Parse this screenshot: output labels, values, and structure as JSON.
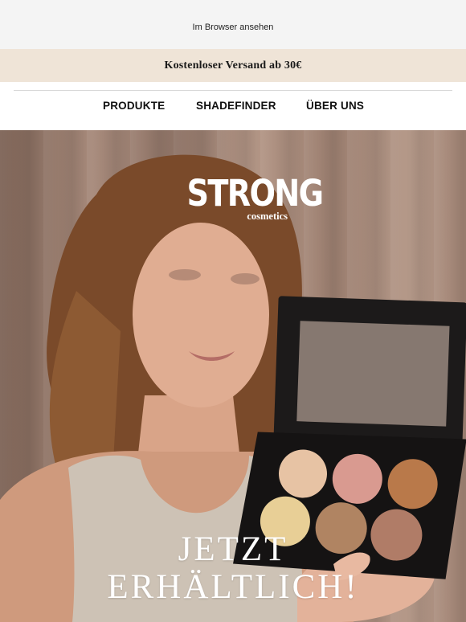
{
  "topbar": {
    "view_in_browser": "Im Browser ansehen"
  },
  "shipping": {
    "text": "Kostenloser Versand ab 30€"
  },
  "nav": {
    "items": [
      "PRODUKTE",
      "SHADEFINDER",
      "ÜBER UNS"
    ]
  },
  "hero": {
    "brand_word": "STRONG",
    "brand_sub": "cosmetics",
    "headline_line1": "JETZT",
    "headline_line2": "ERHÄLTLICH!"
  },
  "colors": {
    "shipping_bg": "#efe4d7",
    "accent": "#111111",
    "hero_bg": "#a78a7b"
  }
}
